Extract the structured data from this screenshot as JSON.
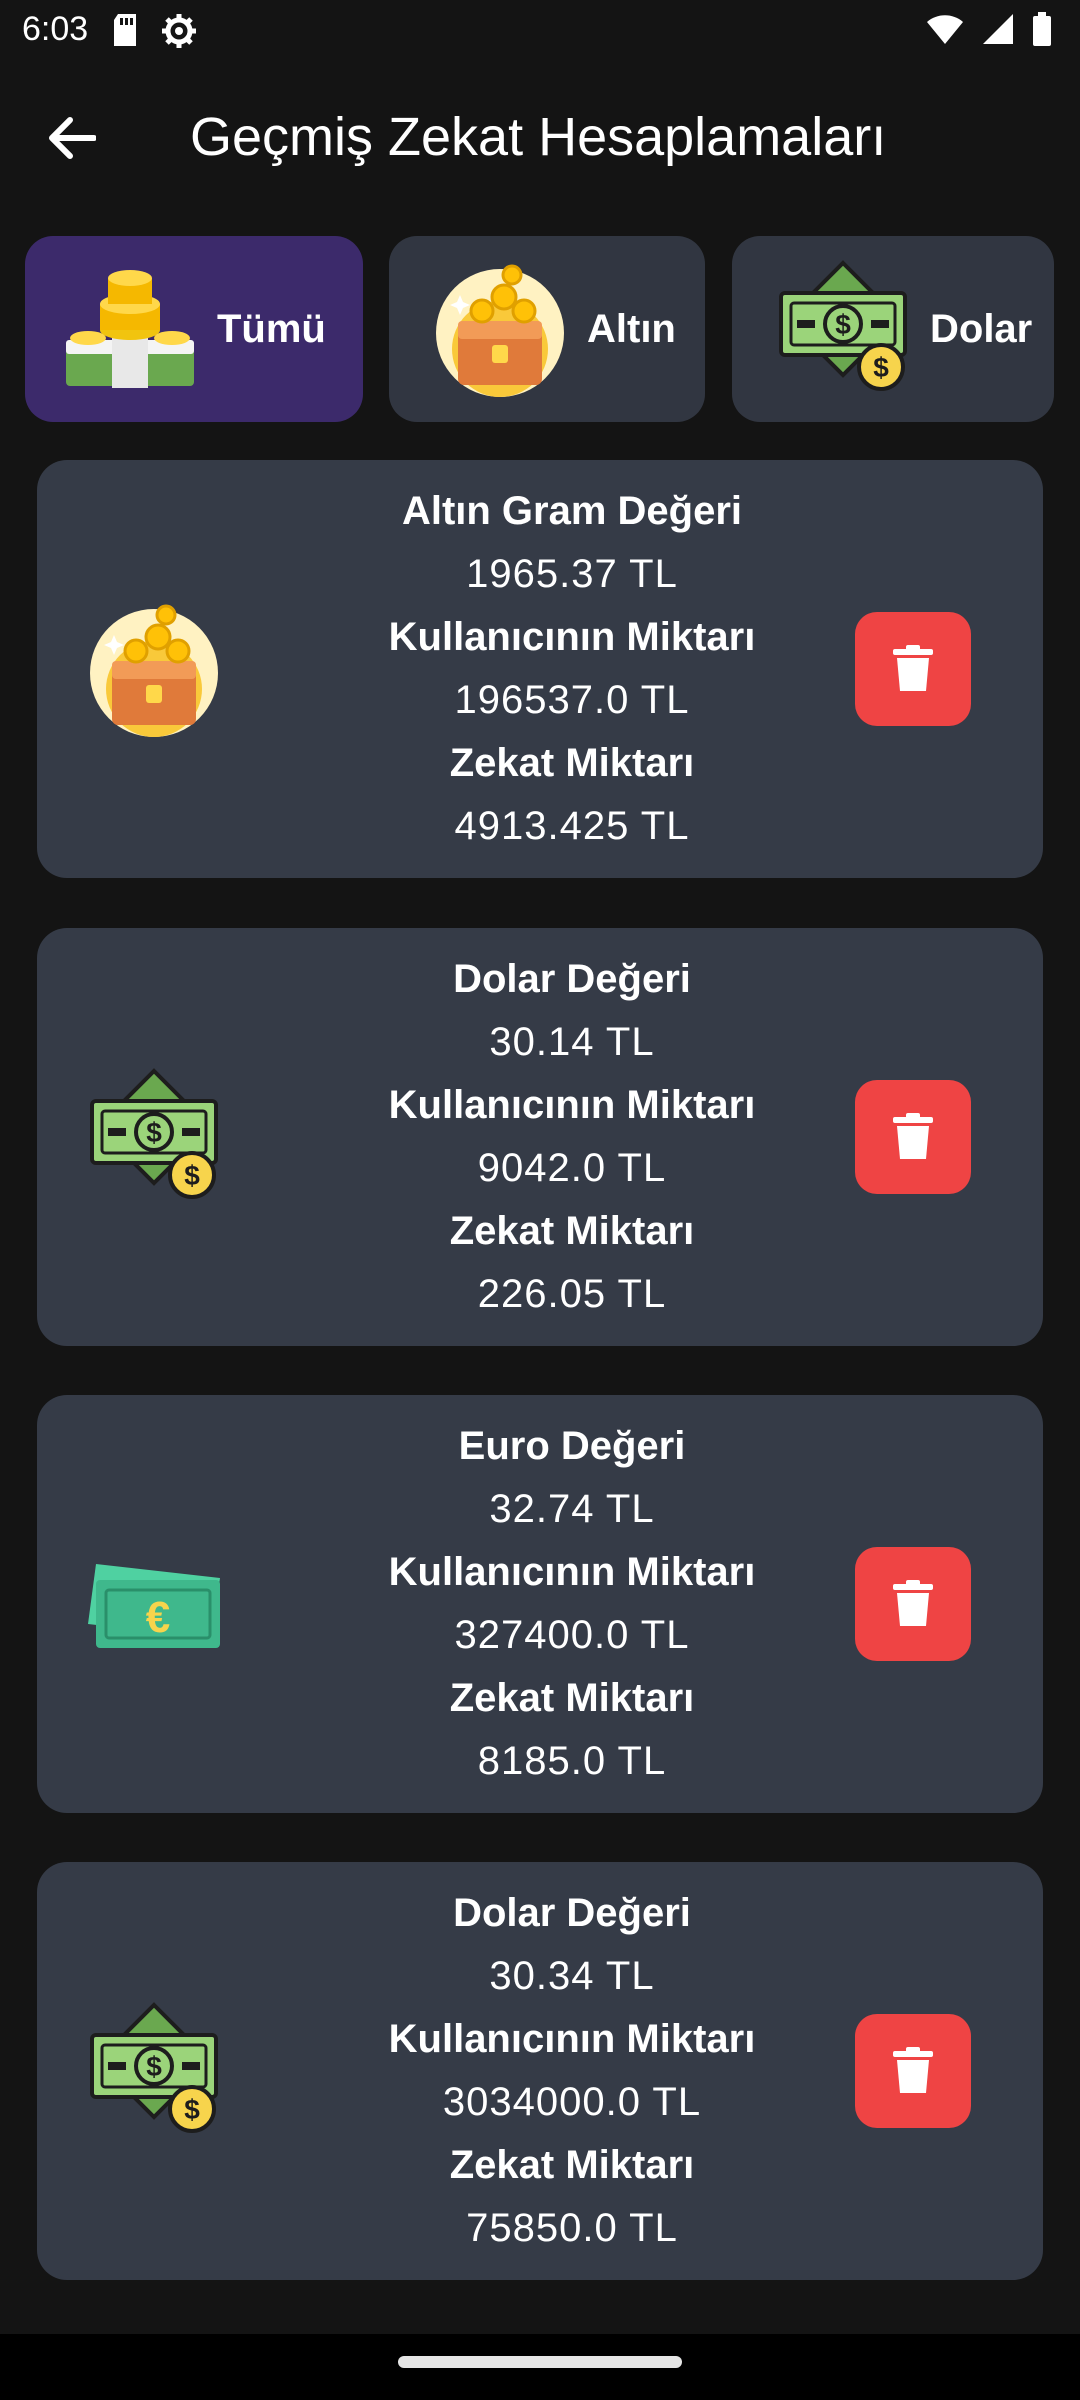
{
  "status_bar": {
    "time": "6:03",
    "icons": [
      "sd-card-icon",
      "settings-icon",
      "wifi-icon",
      "signal-icon",
      "battery-icon"
    ]
  },
  "app_bar": {
    "title": "Geçmiş Zekat Hesaplamaları",
    "back_icon": "arrow-left-icon"
  },
  "filters": [
    {
      "label": "Tümü",
      "icon": "money-stack-icon",
      "active": true
    },
    {
      "label": "Altın",
      "icon": "gold-chest-icon",
      "active": false
    },
    {
      "label": "Dolar",
      "icon": "dollar-bill-icon",
      "active": false
    }
  ],
  "records": [
    {
      "icon": "gold-chest-icon",
      "value_label": "Altın Gram Değeri",
      "value": "1965.37 TL",
      "amount_label": "Kullanıcının Miktarı",
      "amount": "196537.0 TL",
      "zakat_label": "Zekat Miktarı",
      "zakat": "4913.425 TL"
    },
    {
      "icon": "dollar-bill-icon",
      "value_label": "Dolar Değeri",
      "value": "30.14 TL",
      "amount_label": "Kullanıcının Miktarı",
      "amount": "9042.0 TL",
      "zakat_label": "Zekat Miktarı",
      "zakat": "226.05 TL"
    },
    {
      "icon": "euro-bill-icon",
      "value_label": "Euro Değeri",
      "value": "32.74 TL",
      "amount_label": "Kullanıcının Miktarı",
      "amount": "327400.0 TL",
      "zakat_label": "Zekat Miktarı",
      "zakat": "8185.0 TL"
    },
    {
      "icon": "dollar-bill-icon",
      "value_label": "Dolar Değeri",
      "value": "30.34 TL",
      "amount_label": "Kullanıcının Miktarı",
      "amount": "3034000.0 TL",
      "zakat_label": "Zekat Miktarı",
      "zakat": "75850.0 TL"
    }
  ],
  "colors": {
    "background": "#141414",
    "card": "#353b47",
    "chip": "#313641",
    "chip_active": "#3c2a6b",
    "delete": "#ef4444"
  }
}
